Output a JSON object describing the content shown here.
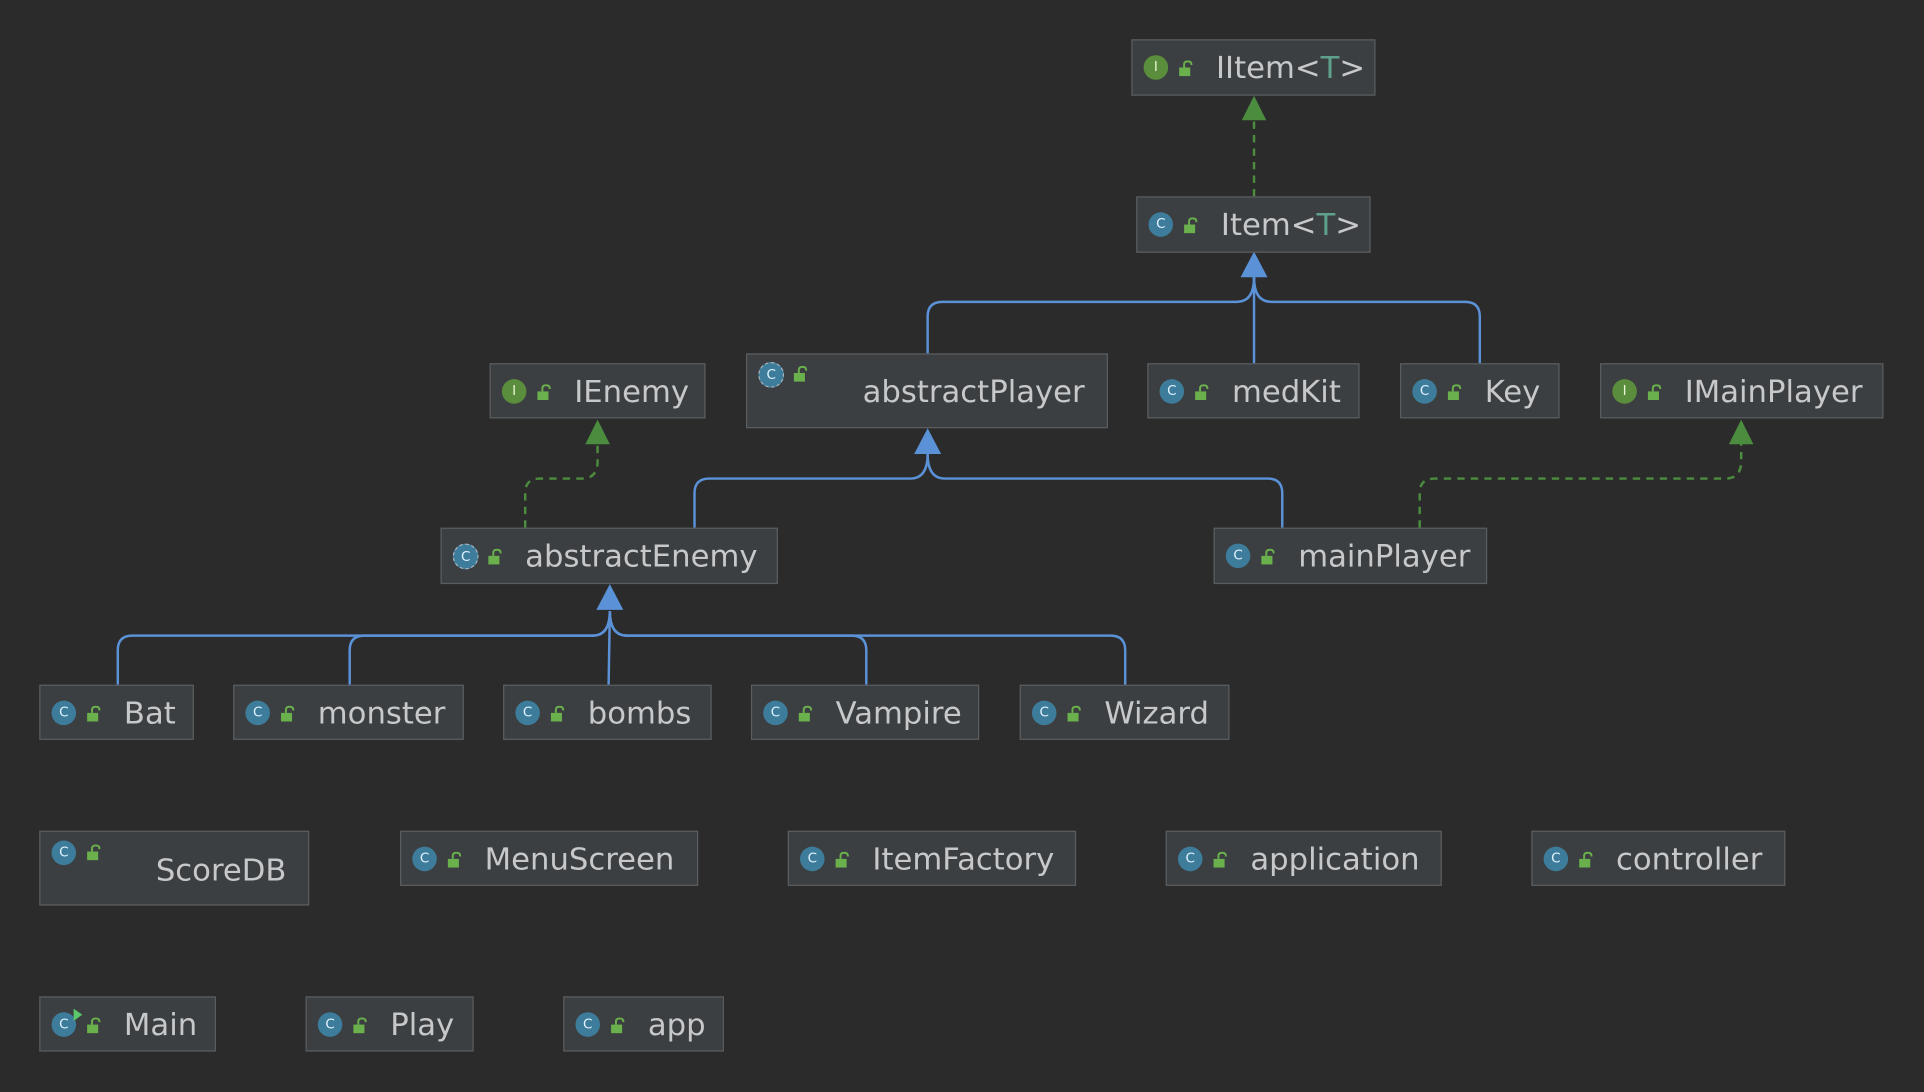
{
  "colors": {
    "background": "#2b2b2b",
    "node_fill": "#3c3f41",
    "node_border": "#5b5e60",
    "text": "#c6c8ca",
    "type_param": "#5fa08c",
    "class_badge": "#3d7d9b",
    "interface_badge": "#5b8e3c",
    "extends_edge": "#5b91d6",
    "implements_edge": "#4c8c3e"
  },
  "nodes": {
    "iitem": {
      "kind": "interface",
      "badge": "I",
      "name": "IItem<",
      "type_param": "T",
      "suffix": ">"
    },
    "item": {
      "kind": "class",
      "badge": "C",
      "name": "Item<",
      "type_param": "T",
      "suffix": ">"
    },
    "ienemy": {
      "kind": "interface",
      "badge": "I",
      "name": "IEnemy"
    },
    "abstractplayer": {
      "kind": "abstract",
      "badge": "C",
      "name": "abstractPlayer"
    },
    "medkit": {
      "kind": "class",
      "badge": "C",
      "name": "medKit"
    },
    "key": {
      "kind": "class",
      "badge": "C",
      "name": "Key"
    },
    "imainplayer": {
      "kind": "interface",
      "badge": "I",
      "name": "IMainPlayer"
    },
    "abstractenemy": {
      "kind": "abstract",
      "badge": "C",
      "name": "abstractEnemy"
    },
    "mainplayer": {
      "kind": "class",
      "badge": "C",
      "name": "mainPlayer"
    },
    "bat": {
      "kind": "class",
      "badge": "C",
      "name": "Bat"
    },
    "monster": {
      "kind": "class",
      "badge": "C",
      "name": "monster"
    },
    "bombs": {
      "kind": "class",
      "badge": "C",
      "name": "bombs"
    },
    "vampire": {
      "kind": "class",
      "badge": "C",
      "name": "Vampire"
    },
    "wizard": {
      "kind": "class",
      "badge": "C",
      "name": "Wizard"
    },
    "scoredb": {
      "kind": "class",
      "badge": "C",
      "name": "ScoreDB"
    },
    "menuscreen": {
      "kind": "class",
      "badge": "C",
      "name": "MenuScreen"
    },
    "itemfactory": {
      "kind": "class",
      "badge": "C",
      "name": "ItemFactory"
    },
    "application": {
      "kind": "class",
      "badge": "C",
      "name": "application"
    },
    "controller": {
      "kind": "class",
      "badge": "C",
      "name": "controller"
    },
    "main": {
      "kind": "runnable",
      "badge": "C",
      "name": "Main"
    },
    "play": {
      "kind": "class",
      "badge": "C",
      "name": "Play"
    },
    "app": {
      "kind": "class",
      "badge": "C",
      "name": "app"
    }
  },
  "edges": [
    {
      "from": "item",
      "to": "iitem",
      "type": "implements"
    },
    {
      "from": "abstractplayer",
      "to": "item",
      "type": "extends"
    },
    {
      "from": "medkit",
      "to": "item",
      "type": "extends"
    },
    {
      "from": "key",
      "to": "item",
      "type": "extends"
    },
    {
      "from": "abstractenemy",
      "to": "ienemy",
      "type": "implements"
    },
    {
      "from": "abstractenemy",
      "to": "abstractplayer",
      "type": "extends"
    },
    {
      "from": "mainplayer",
      "to": "abstractplayer",
      "type": "extends"
    },
    {
      "from": "mainplayer",
      "to": "imainplayer",
      "type": "implements"
    },
    {
      "from": "bat",
      "to": "abstractenemy",
      "type": "extends"
    },
    {
      "from": "monster",
      "to": "abstractenemy",
      "type": "extends"
    },
    {
      "from": "bombs",
      "to": "abstractenemy",
      "type": "extends"
    },
    {
      "from": "vampire",
      "to": "abstractenemy",
      "type": "extends"
    },
    {
      "from": "wizard",
      "to": "abstractenemy",
      "type": "extends"
    }
  ]
}
